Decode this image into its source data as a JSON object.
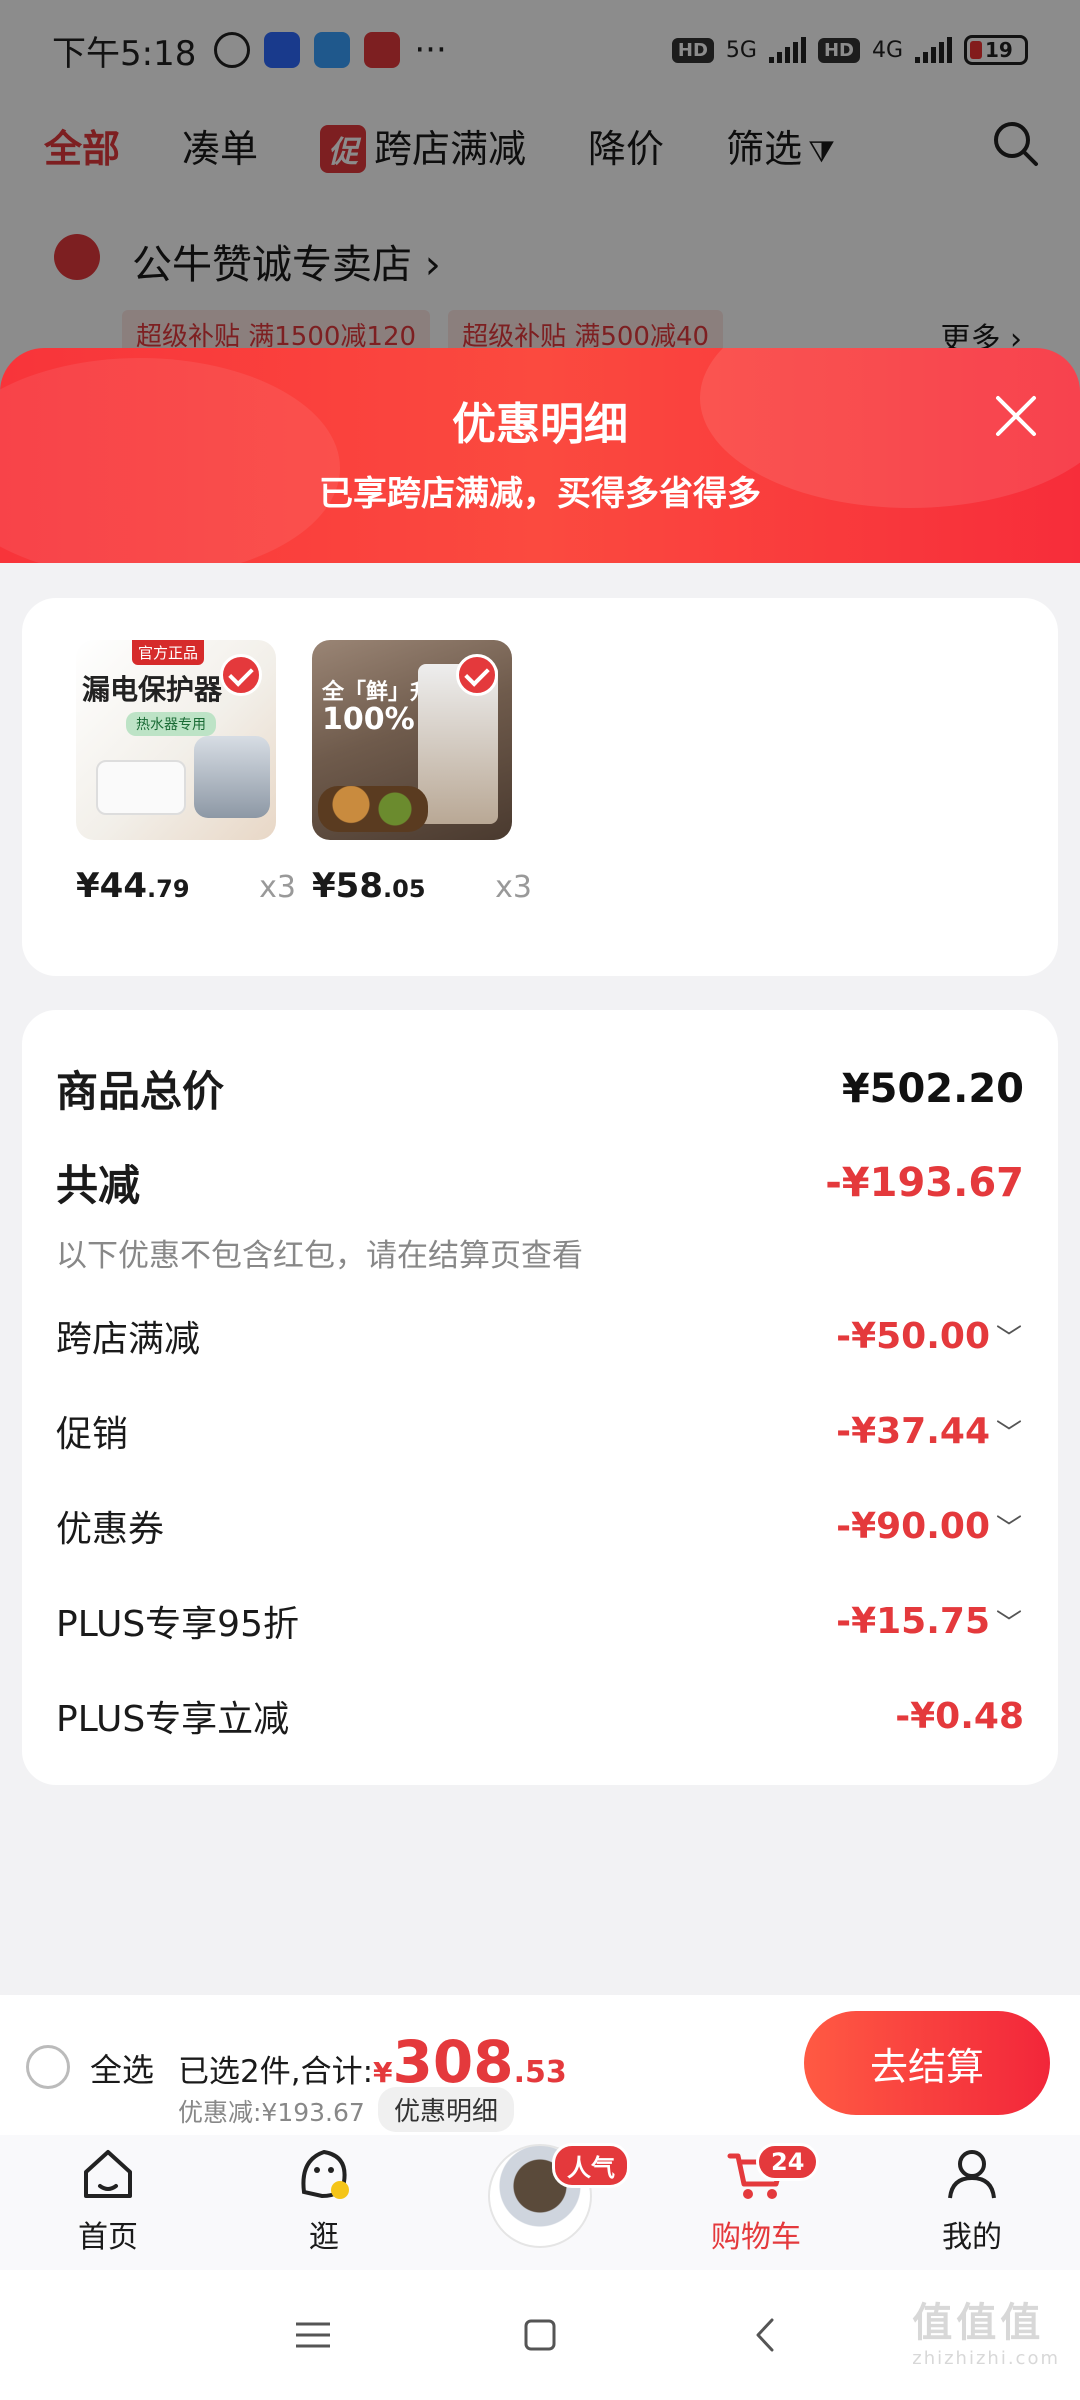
{
  "status_bar": {
    "time": "下午5:18",
    "battery": "19",
    "net1": "5G",
    "net2": "4G",
    "hd": "HD",
    "more": "···"
  },
  "top_nav": {
    "items": [
      "全部",
      "凑单",
      "跨店满减",
      "降价",
      "筛选"
    ],
    "promo_tag": "促"
  },
  "store": {
    "name": "公牛赞诚专卖店",
    "tags": [
      "超级补贴  满1500减120",
      "超级补贴  满500减40"
    ],
    "more": "更多"
  },
  "sheet": {
    "title": "优惠明细",
    "subtitle": "已享跨店满减，买得多省得多"
  },
  "products": [
    {
      "badge": "官方正品",
      "title": "漏电保护器",
      "subtitle": "热水器专用",
      "price_int": "44",
      "price_dec": ".79",
      "qty": "x3"
    },
    {
      "title": "全「鲜」升级",
      "subtitle": "100%",
      "price_int": "58",
      "price_dec": ".05",
      "qty": "x3"
    }
  ],
  "summary": {
    "total_label": "商品总价",
    "total_value": "¥502.20",
    "saved_label": "共减",
    "saved_value": "-¥193.67",
    "note": "以下优惠不包含红包，请在结算页查看",
    "items": [
      {
        "label": "跨店满减",
        "value": "-¥50.00"
      },
      {
        "label": "促销",
        "value": "-¥37.44"
      },
      {
        "label": "优惠券",
        "value": "-¥90.00"
      },
      {
        "label": "PLUS专享95折",
        "value": "-¥15.75"
      },
      {
        "label": "PLUS专享立减",
        "value": "-¥0.48"
      }
    ]
  },
  "checkout": {
    "select_all": "全选",
    "selected_prefix": "已选2件,合计:",
    "currency": "¥",
    "total_int": "308",
    "total_dec": ".53",
    "saved_text": "优惠减:¥193.67",
    "detail_btn": "优惠明细",
    "submit": "去结算"
  },
  "tabbar": {
    "home": "首页",
    "browse": "逛",
    "featured_badge": "人气",
    "cart": "购物车",
    "cart_badge": "24",
    "mine": "我的"
  },
  "watermark": {
    "main": "值值值",
    "url": "zhizhizhi.com"
  },
  "colors": {
    "accent": "#e4393c",
    "sheet_gradient": "#fb4a3f"
  }
}
